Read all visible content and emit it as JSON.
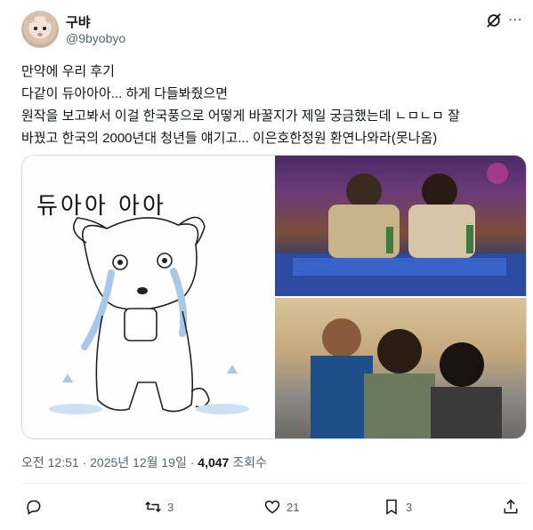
{
  "author": {
    "display_name": "구뱌",
    "handle": "@9byobyo"
  },
  "tweet": {
    "text": "만약에 우리 후기\n다같이 듀아아아... 하게 다들봐줬으면\n원작을 보고봐서 이걸 한국풍으로 어떻게 바꿀지가 제일 궁금했는데 ㄴㅁㄴㅁ 잘\n바꿨고 한국의 2000년대 청년들 얘기고... 이은호한정원 환연나와라(못나옴)",
    "drawing_caption": "듀아아 아아"
  },
  "meta": {
    "timestamp": "오전 12:51 · 2025년 12월 19일 · ",
    "views_count": "4,047",
    "views_label": " 조회수"
  },
  "actions": {
    "reply_count": "",
    "retweet_count": "3",
    "like_count": "21",
    "bookmark_count": "3"
  },
  "icons": [
    "grok-icon",
    "more-icon",
    "reply-icon",
    "retweet-icon",
    "like-icon",
    "bookmark-icon",
    "share-icon"
  ],
  "colors": {
    "text_primary": "#0f1419",
    "text_secondary": "#536471",
    "border": "#cfd9de"
  }
}
